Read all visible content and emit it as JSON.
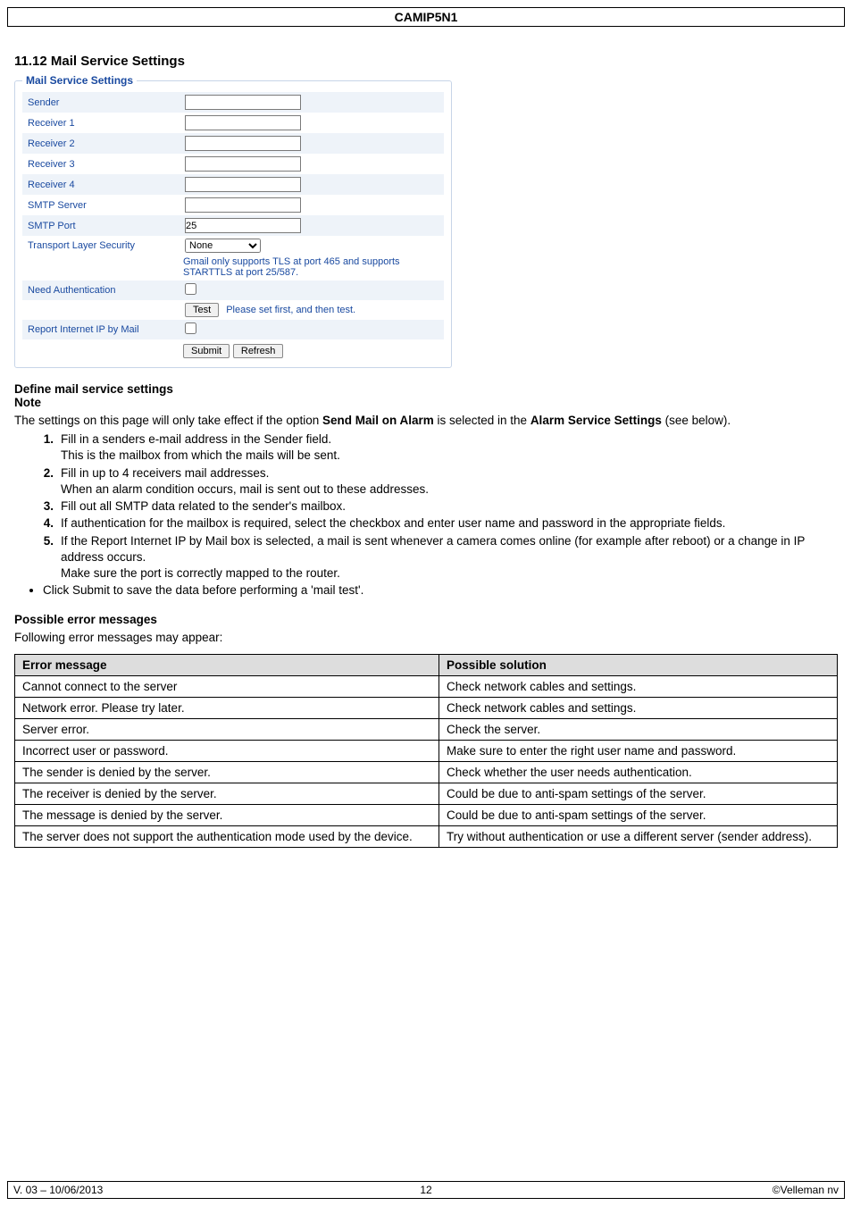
{
  "header_title": "CAMIP5N1",
  "section_heading": "11.12 Mail Service Settings",
  "fieldset_legend": "Mail Service Settings",
  "form": {
    "sender": "Sender",
    "receiver1": "Receiver 1",
    "receiver2": "Receiver 2",
    "receiver3": "Receiver 3",
    "receiver4": "Receiver 4",
    "smtp_server": "SMTP Server",
    "smtp_port": "SMTP Port",
    "smtp_port_value": "25",
    "tls": "Transport Layer Security",
    "tls_value": "None",
    "tls_note": "Gmail only supports TLS at port 465 and supports STARTTLS at port 25/587.",
    "need_auth": "Need Authentication",
    "test_btn": "Test",
    "test_note": "Please set first, and then test.",
    "report_ip": "Report Internet IP by Mail",
    "submit_btn": "Submit",
    "refresh_btn": "Refresh"
  },
  "define_heading": "Define mail service settings",
  "note_heading": "Note",
  "note_body_1": "The settings on this page will only take effect if the option ",
  "note_bold_1": "Send Mail on Alarm",
  "note_body_2": " is selected in the ",
  "note_bold_2": "Alarm Service Settings",
  "note_body_3": " (see below).",
  "steps": [
    {
      "main": "Fill in a senders e-mail address in the Sender field.",
      "sub": "This is the mailbox from which the mails will be sent."
    },
    {
      "main": "Fill in up to 4 receivers mail addresses.",
      "sub": "When an alarm condition occurs, mail is sent out to these addresses."
    },
    {
      "main": "Fill out all SMTP data related to the sender's mailbox."
    },
    {
      "main": "If authentication for the mailbox is required, select the checkbox and enter user name and password in the appropriate fields."
    },
    {
      "main": "If the Report Internet IP by Mail box is selected, a mail is sent whenever a camera comes online (for example after reboot) or a change in IP address occurs.",
      "sub": "Make sure the port is correctly mapped to the router."
    }
  ],
  "bullet": "Click Submit to save the data before performing a 'mail test'.",
  "errors_heading": "Possible error messages",
  "errors_intro": "Following error messages may appear:",
  "table_headers": {
    "c1": "Error message",
    "c2": "Possible solution"
  },
  "table_rows": [
    {
      "c1": "Cannot connect to the server",
      "c2": "Check network cables and settings."
    },
    {
      "c1": "Network error. Please try later.",
      "c2": "Check network cables and settings."
    },
    {
      "c1": "Server error.",
      "c2": "Check the server."
    },
    {
      "c1": "Incorrect user or password.",
      "c2": "Make sure to enter the right user name and password."
    },
    {
      "c1": "The sender is denied by the server.",
      "c2": "Check whether the user needs authentication."
    },
    {
      "c1": "The receiver is denied by the server.",
      "c2": "Could be due to anti-spam settings of the server."
    },
    {
      "c1": "The message is denied by the server.",
      "c2": "Could be due to anti-spam settings of the server."
    },
    {
      "c1": "The server does not support the authentication mode used by the device.",
      "c2": "Try without authentication or use a different server (sender address)."
    }
  ],
  "footer": {
    "left": "V. 03 – 10/06/2013",
    "center": "12",
    "right": "©Velleman nv"
  }
}
